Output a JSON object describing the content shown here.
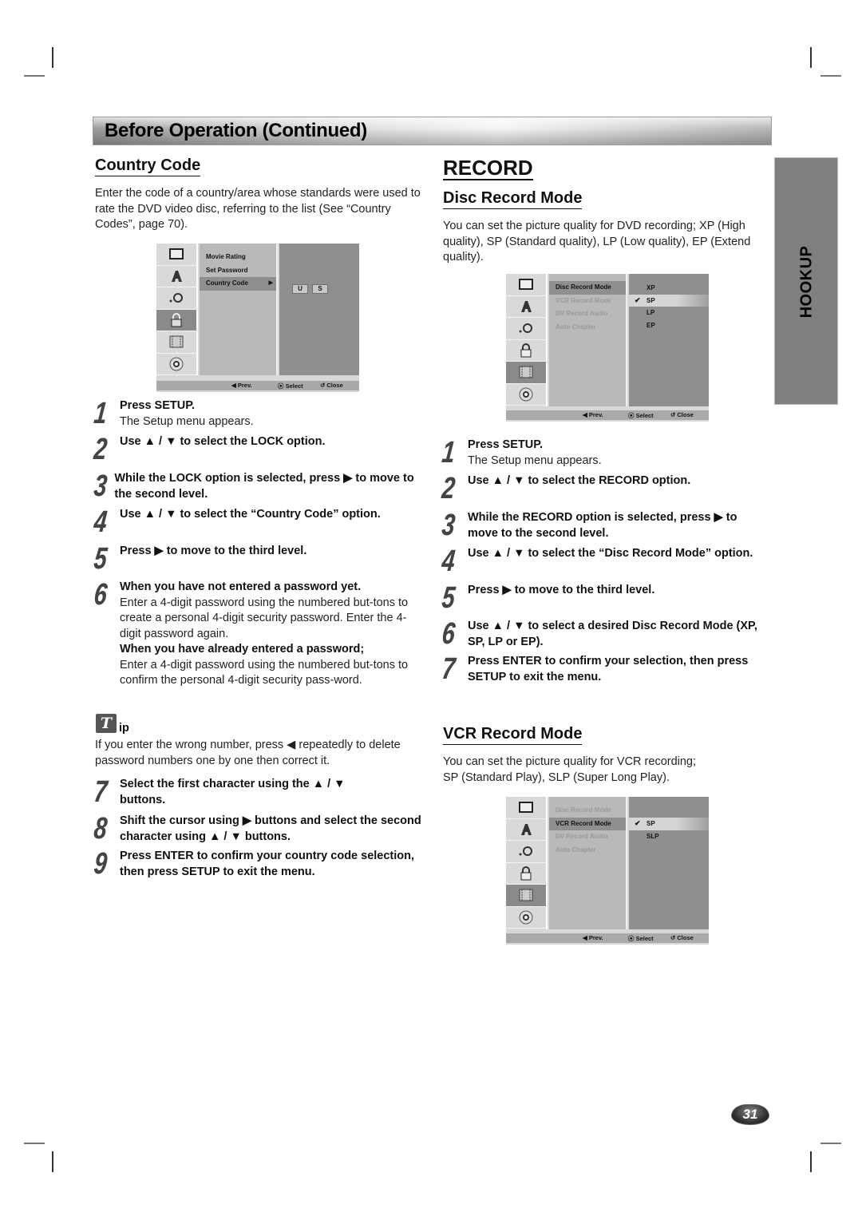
{
  "banner": {
    "title": "Before Operation (Continued)"
  },
  "side_tab": {
    "label": "HOOKUP"
  },
  "page_number": "31",
  "left": {
    "heading": "Country Code",
    "intro": "Enter the code of a country/area whose standards were used to rate the DVD video disc, referring to the list (See “Country Codes”, page 70).",
    "menu": {
      "icons": [
        "tv-icon",
        "language-icon",
        "audio-icon",
        "lock-icon",
        "record-icon",
        "disc-icon"
      ],
      "selected_icon": "lock-icon",
      "items": [
        {
          "label": "Movie Rating",
          "state": "normal"
        },
        {
          "label": "Set Password",
          "state": "normal"
        },
        {
          "label": "Country Code",
          "state": "selected",
          "arrow": "▶"
        }
      ],
      "code_chars": [
        "U",
        "S"
      ],
      "footer": {
        "prev": "◀ Prev.",
        "select": "⦿ Select",
        "close": "↺ Close"
      }
    },
    "steps": [
      {
        "n": "1",
        "bold": "Press SETUP.",
        "normal": "The Setup menu appears."
      },
      {
        "n": "2",
        "bold": "Use ▲ / ▼ to select the LOCK option."
      },
      {
        "n": "3",
        "bold": "While the LOCK option is selected, press ▶ to move to the second level."
      },
      {
        "n": "4",
        "bold": "Use ▲ / ▼ to select the “Country Code” option."
      },
      {
        "n": "5",
        "bold": "Press ▶ to move to the third level."
      },
      {
        "n": "6",
        "bold": "When you have not entered a password yet.",
        "normal": "Enter a 4-digit password using the numbered but-tons to create a personal 4-digit security password. Enter the 4-digit password again.",
        "bold2": "When you have already entered a password;",
        "normal2": "Enter a 4-digit password using the numbered but-tons to confirm the personal 4-digit security pass-word."
      }
    ],
    "tip": {
      "icon_letter": "T",
      "label": "ip",
      "text": "If you enter the wrong number, press ◀ repeatedly to delete password numbers one by one then correct it."
    },
    "steps2": [
      {
        "n": "7",
        "bold": "Select the first character using the ▲ / ▼ buttons."
      },
      {
        "n": "8",
        "bold": "Shift the cursor using ▶ buttons and select the second character using ▲ / ▼ buttons."
      },
      {
        "n": "9",
        "bold": "Press ENTER to confirm your country code selection, then press SETUP to exit the menu."
      }
    ]
  },
  "right": {
    "heading": "RECORD",
    "disc": {
      "heading": "Disc Record Mode",
      "intro": "You can set the picture quality for DVD recording; XP (High quality), SP (Standard quality), LP (Low quality), EP (Extend quality).",
      "menu": {
        "items": [
          {
            "label": "Disc Record Mode",
            "state": "selected"
          },
          {
            "label": "VCR Record Mode",
            "state": "dim"
          },
          {
            "label": "DV Record Audio",
            "state": "dim"
          },
          {
            "label": "Auto Chapter",
            "state": "dim"
          }
        ],
        "options": [
          "XP",
          "SP",
          "LP",
          "EP"
        ],
        "checked_option": "SP",
        "footer": {
          "prev": "◀ Prev.",
          "select": "⦿ Select",
          "close": "↺ Close"
        }
      },
      "steps": [
        {
          "n": "1",
          "bold": "Press SETUP.",
          "normal": "The Setup menu appears."
        },
        {
          "n": "2",
          "bold": "Use ▲ / ▼ to select the RECORD option."
        },
        {
          "n": "3",
          "bold": "While the RECORD option is selected, press ▶ to move to the second level."
        },
        {
          "n": "4",
          "bold": "Use ▲ / ▼ to select the “Disc Record Mode” option."
        },
        {
          "n": "5",
          "bold": "Press ▶ to move to the third level."
        },
        {
          "n": "6",
          "bold": "Use ▲ / ▼ to select a desired Disc Record Mode (XP, SP, LP or EP)."
        },
        {
          "n": "7",
          "bold": "Press ENTER to confirm your selection, then press SETUP to exit the menu."
        }
      ]
    },
    "vcr": {
      "heading": "VCR Record Mode",
      "intro": "You can set the picture quality for VCR recording; SP (Standard Play), SLP (Super Long Play).",
      "menu": {
        "items": [
          {
            "label": "Disc Record Mode",
            "state": "dim"
          },
          {
            "label": "VCR Record Mode",
            "state": "selected"
          },
          {
            "label": "DV Record Audio",
            "state": "dim"
          },
          {
            "label": "Auto Chapter",
            "state": "dim"
          }
        ],
        "options": [
          "SP",
          "SLP"
        ],
        "checked_option": "SP",
        "footer": {
          "prev": "◀ Prev.",
          "select": "⦿ Select",
          "close": "↺ Close"
        }
      }
    }
  }
}
